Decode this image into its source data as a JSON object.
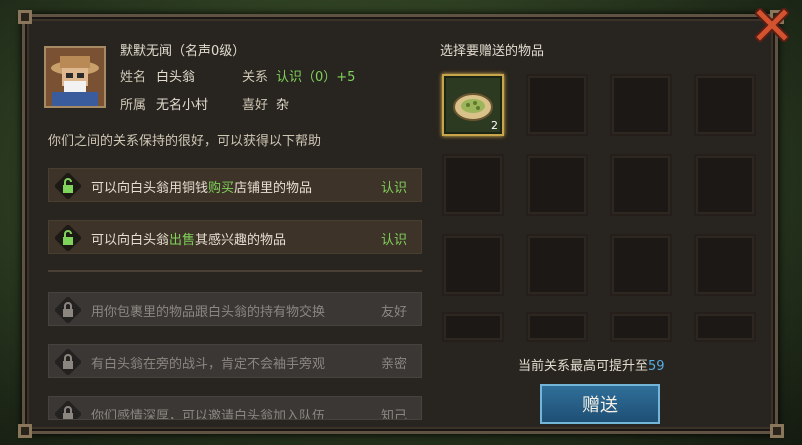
{
  "npc": {
    "title": "默默无闻（名声0级）",
    "name_label": "姓名",
    "name": "白头翁",
    "relation_label": "关系",
    "relation_value": "认识（0）+5",
    "region_label": "所属",
    "region": "无名小村",
    "likes_label": "喜好",
    "likes": "杂"
  },
  "intro_text": "你们之间的关系保持的很好，可以获得以下帮助",
  "benefits": [
    {
      "pre": "可以向白头翁用铜钱",
      "hl": "购买",
      "post": "店铺里的物品",
      "level": "认识",
      "locked": false
    },
    {
      "pre": "可以向白头翁",
      "hl": "出售",
      "post": "其感兴趣的物品",
      "level": "认识",
      "locked": false
    },
    {
      "pre": "用你包裹里的物品跟白头翁的持有物交换",
      "hl": "",
      "post": "",
      "level": "友好",
      "locked": true
    },
    {
      "pre": "有白头翁在旁的战斗，肯定不会袖手旁观",
      "hl": "",
      "post": "",
      "level": "亲密",
      "locked": true
    },
    {
      "pre": "你们感情深厚，可以邀请白头翁加入队伍",
      "hl": "",
      "post": "",
      "level": "知己",
      "locked": true
    }
  ],
  "gift": {
    "header": "选择要赠送的物品",
    "item_qty": "2",
    "max_text": "当前关系最高可提升至",
    "max_value": "59",
    "button_label": "赠送"
  },
  "colors": {
    "accent_green": "#7fd25a",
    "gift_button": "#2f6f9a",
    "panel_bg": "#28241f"
  }
}
